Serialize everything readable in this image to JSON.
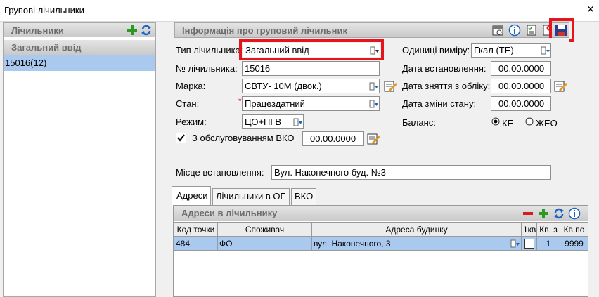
{
  "window": {
    "title": "Групові лічильники",
    "close_label": "×"
  },
  "left": {
    "panel_title": "Лічильники",
    "section_title": "Загальний ввід",
    "items": [
      "15016(12)"
    ]
  },
  "info": {
    "panel_title": "Інформація про груповий лічильник",
    "type_label": "Тип лічильника:",
    "type_value": "Загальний ввід",
    "number_label": "№ лічильника:",
    "number_value": "15016",
    "brand_label": "Марка:",
    "brand_value": "СВТУ- 10М (двок.)",
    "state_label": "Стан:",
    "state_required_mark": "*",
    "state_value": "Працездатний",
    "mode_label": "Режим:",
    "mode_value": "ЦО+ПГВ",
    "service_label": "З обслуговуванням ВКО",
    "service_checked": true,
    "service_date": "00.00.0000",
    "units_label": "Одиниці виміру:",
    "units_value": "Гкал (ТЕ)",
    "install_date_label": "Дата встановлення:",
    "install_date_value": "00.00.0000",
    "removal_date_label": "Дата зняття з обліку:",
    "removal_date_value": "00.00.0000",
    "state_change_label": "Дата зміни стану:",
    "state_change_value": "00.00.0000",
    "balance_label": "Баланс:",
    "balance_opt1": "КЕ",
    "balance_opt2": "ЖЕО",
    "balance_selected": "КЕ",
    "location_label": "Місце встановлення:",
    "location_value": "Вул. Наконечного буд. №3"
  },
  "tabs": [
    "Адреси",
    "Лічильники в ОГ",
    "ВКО"
  ],
  "addresses": {
    "panel_title": "Адреси в лічильнику",
    "columns": [
      "Код точки",
      "Споживач",
      "Адреса будинку",
      "1кв",
      "Кв. з",
      "Кв.по"
    ],
    "rows": [
      {
        "code": "484",
        "consumer": "ФО",
        "address": "вул. Наконечного, 3",
        "flat_from": "1",
        "flat_to": "9999"
      }
    ]
  },
  "colors": {
    "highlight": "#e8141c",
    "selection": "#a9c9ef",
    "header_text": "#6d6d6d",
    "green": "#2a9a23",
    "blue": "#1b63c6"
  }
}
